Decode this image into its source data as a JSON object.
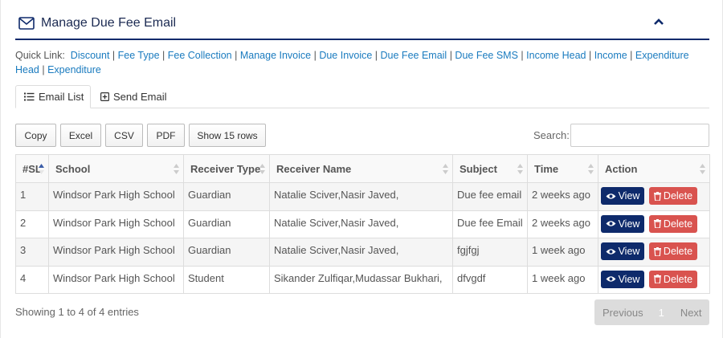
{
  "header": {
    "title": "Manage Due Fee Email"
  },
  "quick_links": {
    "label": "Quick Link:",
    "items": [
      "Discount",
      "Fee Type",
      "Fee Collection",
      "Manage Invoice",
      "Due Invoice",
      "Due Fee Email",
      "Due Fee SMS",
      "Income Head",
      "Income",
      "Expenditure Head",
      "Expenditure"
    ]
  },
  "tabs": {
    "list": "Email List",
    "send": "Send Email"
  },
  "toolbar": {
    "copy": "Copy",
    "excel": "Excel",
    "csv": "CSV",
    "pdf": "PDF",
    "rows": "Show 15 rows"
  },
  "search": {
    "label": "Search:",
    "value": ""
  },
  "table": {
    "columns": [
      "#SL",
      "School",
      "Receiver Type",
      "Receiver Name",
      "Subject",
      "Time",
      "Action"
    ],
    "rows": [
      {
        "sl": "1",
        "school": "Windsor Park High School",
        "type": "Guardian",
        "name": "Natalie Sciver,Nasir Javed,",
        "subject": "Due fee email",
        "time": "2 weeks ago"
      },
      {
        "sl": "2",
        "school": "Windsor Park High School",
        "type": "Guardian",
        "name": "Natalie Sciver,Nasir Javed,",
        "subject": "Due fee Email",
        "time": "2 weeks ago"
      },
      {
        "sl": "3",
        "school": "Windsor Park High School",
        "type": "Guardian",
        "name": "Natalie Sciver,Nasir Javed,",
        "subject": "fgjfgj",
        "time": "1 week ago"
      },
      {
        "sl": "4",
        "school": "Windsor Park High School",
        "type": "Student",
        "name": "Sikander Zulfiqar,Mudassar Bukhari,",
        "subject": "dfvgdf",
        "time": "1 week ago"
      }
    ],
    "actions": {
      "view": "View",
      "delete": "Delete"
    }
  },
  "footer": {
    "info": "Showing 1 to 4 of 4 entries",
    "previous": "Previous",
    "page": "1",
    "next": "Next"
  },
  "colors": {
    "primary": "#0e2a6b",
    "link": "#1a7bbf",
    "danger": "#d9534f"
  },
  "icons": {
    "header": "envelope-icon",
    "collapse": "chevron-up-icon",
    "list_tab": "list-icon",
    "send_tab": "plus-square-icon",
    "view": "eye-icon",
    "delete": "trash-icon"
  }
}
